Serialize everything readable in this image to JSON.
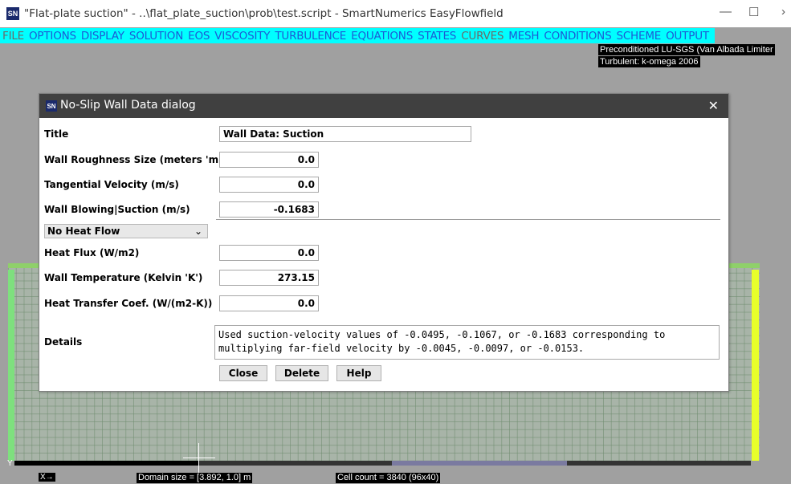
{
  "window": {
    "title": "\"Flat-plate suction\" - ..\\flat_plate_suction\\prob\\test.script - SmartNumerics EasyFlowfield",
    "icon_text": "SN",
    "minimize": "—",
    "maximize": "☐",
    "close": "›"
  },
  "menu": [
    {
      "label": "FILE",
      "enabled": false
    },
    {
      "label": "OPTIONS",
      "enabled": true
    },
    {
      "label": "DISPLAY",
      "enabled": true
    },
    {
      "label": "SOLUTION",
      "enabled": true
    },
    {
      "label": "EOS",
      "enabled": true
    },
    {
      "label": "VISCOSITY",
      "enabled": true
    },
    {
      "label": "TURBULENCE",
      "enabled": true
    },
    {
      "label": "EQUATIONS",
      "enabled": true
    },
    {
      "label": "STATES",
      "enabled": true
    },
    {
      "label": "CURVES",
      "enabled": false
    },
    {
      "label": "MESH",
      "enabled": true
    },
    {
      "label": "CONDITIONS",
      "enabled": true
    },
    {
      "label": "SCHEME",
      "enabled": true
    },
    {
      "label": "OUTPUT",
      "enabled": true
    }
  ],
  "info": {
    "line1": "Preconditioned LU-SGS (Van Albada Limiter",
    "line2": "Turbulent: k-omega 2006"
  },
  "footer": {
    "y_axis": "Y",
    "x_axis": "X→",
    "domain_size": "Domain size = [3.892, 1.0] m",
    "cell_count": "Cell count = 3840 (96x40)"
  },
  "dialog": {
    "icon_text": "SN",
    "title": "No-Slip Wall Data dialog",
    "close": "✕",
    "rows": {
      "title": {
        "label": "Title",
        "value": "Wall  Data: Suction"
      },
      "roughness": {
        "label": "Wall Roughness Size (meters 'm')",
        "value": "0.0"
      },
      "tangential": {
        "label": "Tangential Velocity (m/s)",
        "value": "0.0"
      },
      "blowing": {
        "label": "Wall Blowing|Suction (m/s)",
        "value": "-0.1683"
      },
      "heat_flux": {
        "label": "Heat Flux (W/m2)",
        "value": "0.0"
      },
      "temperature": {
        "label": "Wall Temperature (Kelvin 'K')",
        "value": "273.15"
      },
      "htc": {
        "label": "Heat Transfer Coef. (W/(m2-K))",
        "value": "0.0"
      }
    },
    "heat_mode": {
      "selected": "No Heat Flow",
      "chevron": "⌄"
    },
    "details": {
      "label": "Details",
      "text": "Used suction-velocity values of -0.0495, -0.1067, or -0.1683 corresponding to\nmultiplying far-field velocity by -0.0045, -0.0097, or -0.0153."
    },
    "buttons": {
      "close": "Close",
      "delete": "Delete",
      "help": "Help"
    }
  }
}
